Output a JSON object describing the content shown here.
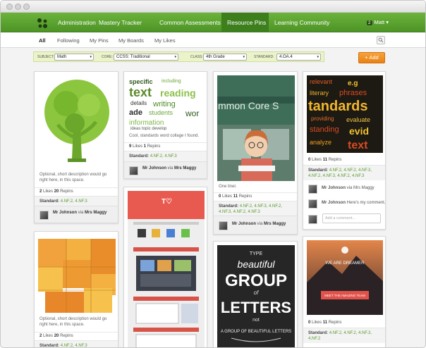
{
  "nav": {
    "items": [
      {
        "label": "Administration",
        "active": false
      },
      {
        "label": "Mastery Tracker",
        "active": false
      },
      {
        "label": "Common Assessments",
        "active": false
      },
      {
        "label": "Resource Pins",
        "active": true
      },
      {
        "label": "Learning Community",
        "active": false
      }
    ],
    "user": {
      "badge": "2",
      "name": "Matt"
    }
  },
  "subnav": {
    "items": [
      {
        "label": "All",
        "active": true
      },
      {
        "label": "Following",
        "active": false
      },
      {
        "label": "My Pins",
        "active": false
      },
      {
        "label": "My Boards",
        "active": false
      },
      {
        "label": "My Likes",
        "active": false
      }
    ],
    "search_icon": "search-icon"
  },
  "filters": {
    "subject": {
      "label": "SUBJECT:",
      "value": "Math"
    },
    "core": {
      "label": "CORE:",
      "value": "CCSS: Traditional"
    },
    "class": {
      "label": "CLASS:",
      "value": "4th Grade"
    },
    "standard": {
      "label": "STANDARD:",
      "value": "4.OA.4"
    }
  },
  "add_button": "+ Add",
  "colors": {
    "nav_green": "#5aa32f",
    "accent_orange": "#f0901e",
    "link_green": "#5a9a2e"
  },
  "cards": {
    "c1": {
      "caption": "Optional, short description would go right here, in this space.",
      "likes": "2",
      "likes_label": "Likes",
      "repins": "20",
      "repins_label": "Repins",
      "std_label": "Standard:",
      "std_links": "4.NF.2, 4.NF.3",
      "pinner": "Mr Johnson",
      "via": "via",
      "source": "Mrs Maggy"
    },
    "c2": {
      "caption": "Cool, standards word collage I found.",
      "likes": "9",
      "likes_label": "Likes",
      "repins": "1",
      "repins_label": "Repins",
      "std_label": "Standard:",
      "std_links": "4.NF.2, 4.NF.3",
      "pinner": "Mr Johnson",
      "via": "via",
      "source": "Mrs Maggy"
    },
    "c3": {
      "banner": "mmon Core S",
      "caption": "One liner.",
      "likes": "0",
      "likes_label": "Likes",
      "repins": "11",
      "repins_label": "Repins",
      "std_label": "Standard:",
      "std_links": "4.NF.2, 4.NF.3, 4.NF.2, 4.NF.3, 4.NF.2, 4.NF.3",
      "pinner": "Mr Johnson",
      "via": "via",
      "source": "Mrs Maggy"
    },
    "c4": {
      "likes": "0",
      "likes_label": "Likes",
      "repins": "11",
      "repins_label": "Repins",
      "std_label": "Standard:",
      "std_links": "4.NF.2, 4.NF.2, 4.NF.3, 4.NF.2, 4.NF.3, 4.NF.2, 4.NF.3",
      "comment1_author": "Mr Johnson",
      "comment1_text": "via Mrs Maggy",
      "comment2_author": "Mr Johnson",
      "comment2_text": "Here's my comment.",
      "comment_placeholder": "Add a comment..."
    },
    "c5": {
      "caption": "Optional, short description would go right here, in this space.",
      "likes": "2",
      "likes_label": "Likes",
      "repins": "20",
      "repins_label": "Repins",
      "std_label": "Standard:",
      "std_links": "4.NF.2, 4.NF.3"
    },
    "c7": {
      "line1": "TYPE",
      "line2": "beautiful",
      "line3": "GROUP",
      "line4": "of",
      "line5": "LETTERS",
      "line6": "not",
      "line7": "A GROUP OF BEAUTIFUL LETTERS"
    },
    "c8": {
      "line1": "WE ARE DREAMER",
      "line2": "MEET THE AMAZING TEAM",
      "likes": "0",
      "likes_label": "Likes",
      "repins": "11",
      "repins_label": "Repins",
      "std_label": "Standard:",
      "std_links": "4.NF.2, 4.NF.2, 4.NF.3, 4.NF.2"
    }
  }
}
